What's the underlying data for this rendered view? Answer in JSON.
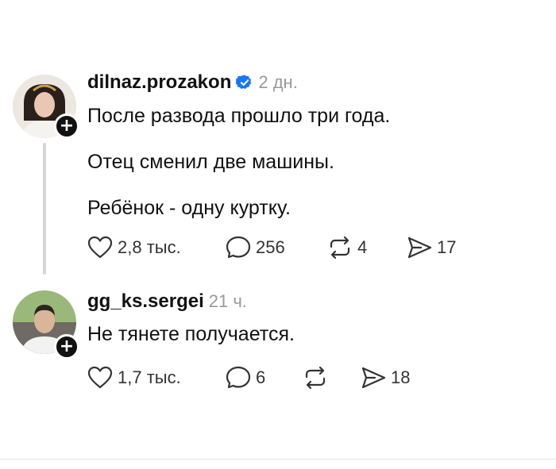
{
  "posts": [
    {
      "username": "dilnaz.prozakon",
      "verified": true,
      "time": "2 дн.",
      "lines": [
        "После развода прошло три года.",
        "Отец сменил две машины.",
        "Ребёнок - одну куртку."
      ],
      "likes": "2,8 тыс.",
      "comments": "256",
      "reposts": "4",
      "shares": "17"
    },
    {
      "username": "gg_ks.sergei",
      "time": "21 ч.",
      "lines": [
        "Не тянете получается."
      ],
      "likes": "1,7 тыс.",
      "comments": "6",
      "reposts": "",
      "shares": "18"
    }
  ],
  "icons": {
    "like": "heart-icon",
    "comment": "comment-bubble-icon",
    "repost": "repost-icon",
    "share": "send-icon",
    "verified": "verified-badge-icon",
    "follow": "plus-icon"
  },
  "colors": {
    "verified": "#1877f2",
    "muted": "#999999"
  }
}
